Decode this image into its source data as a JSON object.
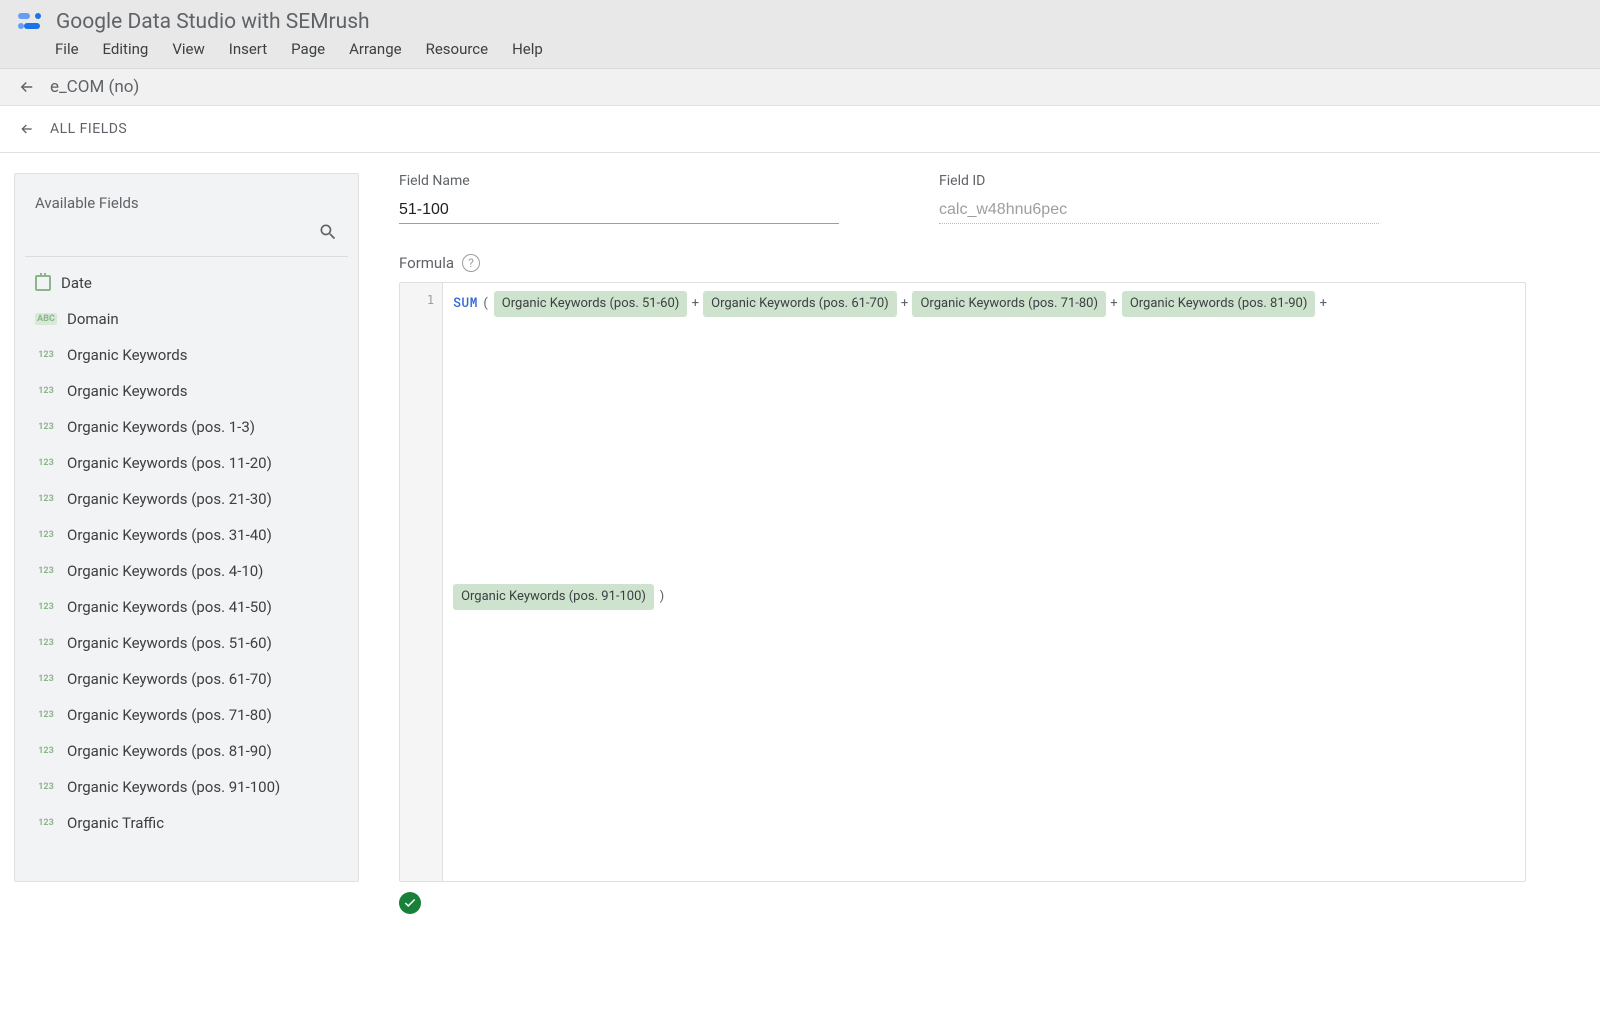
{
  "header": {
    "app_title": "Google Data Studio with SEMrush",
    "menus": [
      "File",
      "Editing",
      "View",
      "Insert",
      "Page",
      "Arrange",
      "Resource",
      "Help"
    ]
  },
  "breadcrumb": {
    "datasource": "e_COM (no)",
    "page_label": "ALL FIELDS"
  },
  "sidebar": {
    "title": "Available Fields",
    "fields": [
      {
        "type": "date",
        "label": "Date"
      },
      {
        "type": "text",
        "label": "Domain"
      },
      {
        "type": "num",
        "label": "Organic Keywords"
      },
      {
        "type": "num",
        "label": "Organic Keywords"
      },
      {
        "type": "num",
        "label": "Organic Keywords (pos. 1-3)"
      },
      {
        "type": "num",
        "label": "Organic Keywords (pos. 11-20)"
      },
      {
        "type": "num",
        "label": "Organic Keywords (pos. 21-30)"
      },
      {
        "type": "num",
        "label": "Organic Keywords (pos. 31-40)"
      },
      {
        "type": "num",
        "label": "Organic Keywords (pos. 4-10)"
      },
      {
        "type": "num",
        "label": "Organic Keywords (pos. 41-50)"
      },
      {
        "type": "num",
        "label": "Organic Keywords (pos. 51-60)"
      },
      {
        "type": "num",
        "label": "Organic Keywords (pos. 61-70)"
      },
      {
        "type": "num",
        "label": "Organic Keywords (pos. 71-80)"
      },
      {
        "type": "num",
        "label": "Organic Keywords (pos. 81-90)"
      },
      {
        "type": "num",
        "label": "Organic Keywords (pos. 91-100)"
      },
      {
        "type": "num",
        "label": "Organic Traffic"
      }
    ]
  },
  "form": {
    "name_label": "Field Name",
    "name_value": "51-100",
    "id_label": "Field ID",
    "id_value": "calc_w48hnu6pec",
    "formula_label": "Formula"
  },
  "formula": {
    "line": "1",
    "fn": "SUM",
    "open": "(",
    "close": ")",
    "op": "+",
    "chips": [
      "Organic Keywords (pos. 51-60)",
      "Organic Keywords (pos. 61-70)",
      "Organic Keywords (pos. 71-80)",
      "Organic Keywords (pos. 81-90)",
      "Organic Keywords (pos. 91-100)"
    ]
  },
  "type_badges": {
    "num": "123",
    "text": "ABC"
  }
}
